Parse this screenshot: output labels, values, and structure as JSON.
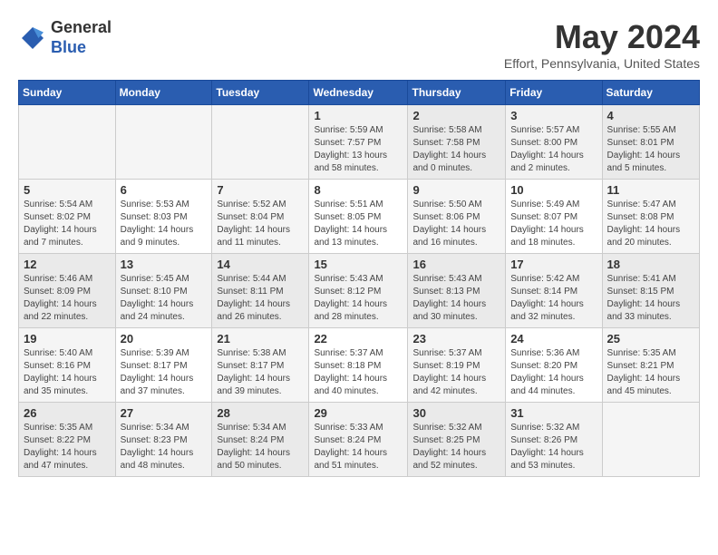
{
  "header": {
    "logo_general": "General",
    "logo_blue": "Blue",
    "month_title": "May 2024",
    "location": "Effort, Pennsylvania, United States"
  },
  "weekdays": [
    "Sunday",
    "Monday",
    "Tuesday",
    "Wednesday",
    "Thursday",
    "Friday",
    "Saturday"
  ],
  "weeks": [
    [
      {
        "day": "",
        "info": ""
      },
      {
        "day": "",
        "info": ""
      },
      {
        "day": "",
        "info": ""
      },
      {
        "day": "1",
        "info": "Sunrise: 5:59 AM\nSunset: 7:57 PM\nDaylight: 13 hours\nand 58 minutes."
      },
      {
        "day": "2",
        "info": "Sunrise: 5:58 AM\nSunset: 7:58 PM\nDaylight: 14 hours\nand 0 minutes."
      },
      {
        "day": "3",
        "info": "Sunrise: 5:57 AM\nSunset: 8:00 PM\nDaylight: 14 hours\nand 2 minutes."
      },
      {
        "day": "4",
        "info": "Sunrise: 5:55 AM\nSunset: 8:01 PM\nDaylight: 14 hours\nand 5 minutes."
      }
    ],
    [
      {
        "day": "5",
        "info": "Sunrise: 5:54 AM\nSunset: 8:02 PM\nDaylight: 14 hours\nand 7 minutes."
      },
      {
        "day": "6",
        "info": "Sunrise: 5:53 AM\nSunset: 8:03 PM\nDaylight: 14 hours\nand 9 minutes."
      },
      {
        "day": "7",
        "info": "Sunrise: 5:52 AM\nSunset: 8:04 PM\nDaylight: 14 hours\nand 11 minutes."
      },
      {
        "day": "8",
        "info": "Sunrise: 5:51 AM\nSunset: 8:05 PM\nDaylight: 14 hours\nand 13 minutes."
      },
      {
        "day": "9",
        "info": "Sunrise: 5:50 AM\nSunset: 8:06 PM\nDaylight: 14 hours\nand 16 minutes."
      },
      {
        "day": "10",
        "info": "Sunrise: 5:49 AM\nSunset: 8:07 PM\nDaylight: 14 hours\nand 18 minutes."
      },
      {
        "day": "11",
        "info": "Sunrise: 5:47 AM\nSunset: 8:08 PM\nDaylight: 14 hours\nand 20 minutes."
      }
    ],
    [
      {
        "day": "12",
        "info": "Sunrise: 5:46 AM\nSunset: 8:09 PM\nDaylight: 14 hours\nand 22 minutes."
      },
      {
        "day": "13",
        "info": "Sunrise: 5:45 AM\nSunset: 8:10 PM\nDaylight: 14 hours\nand 24 minutes."
      },
      {
        "day": "14",
        "info": "Sunrise: 5:44 AM\nSunset: 8:11 PM\nDaylight: 14 hours\nand 26 minutes."
      },
      {
        "day": "15",
        "info": "Sunrise: 5:43 AM\nSunset: 8:12 PM\nDaylight: 14 hours\nand 28 minutes."
      },
      {
        "day": "16",
        "info": "Sunrise: 5:43 AM\nSunset: 8:13 PM\nDaylight: 14 hours\nand 30 minutes."
      },
      {
        "day": "17",
        "info": "Sunrise: 5:42 AM\nSunset: 8:14 PM\nDaylight: 14 hours\nand 32 minutes."
      },
      {
        "day": "18",
        "info": "Sunrise: 5:41 AM\nSunset: 8:15 PM\nDaylight: 14 hours\nand 33 minutes."
      }
    ],
    [
      {
        "day": "19",
        "info": "Sunrise: 5:40 AM\nSunset: 8:16 PM\nDaylight: 14 hours\nand 35 minutes."
      },
      {
        "day": "20",
        "info": "Sunrise: 5:39 AM\nSunset: 8:17 PM\nDaylight: 14 hours\nand 37 minutes."
      },
      {
        "day": "21",
        "info": "Sunrise: 5:38 AM\nSunset: 8:17 PM\nDaylight: 14 hours\nand 39 minutes."
      },
      {
        "day": "22",
        "info": "Sunrise: 5:37 AM\nSunset: 8:18 PM\nDaylight: 14 hours\nand 40 minutes."
      },
      {
        "day": "23",
        "info": "Sunrise: 5:37 AM\nSunset: 8:19 PM\nDaylight: 14 hours\nand 42 minutes."
      },
      {
        "day": "24",
        "info": "Sunrise: 5:36 AM\nSunset: 8:20 PM\nDaylight: 14 hours\nand 44 minutes."
      },
      {
        "day": "25",
        "info": "Sunrise: 5:35 AM\nSunset: 8:21 PM\nDaylight: 14 hours\nand 45 minutes."
      }
    ],
    [
      {
        "day": "26",
        "info": "Sunrise: 5:35 AM\nSunset: 8:22 PM\nDaylight: 14 hours\nand 47 minutes."
      },
      {
        "day": "27",
        "info": "Sunrise: 5:34 AM\nSunset: 8:23 PM\nDaylight: 14 hours\nand 48 minutes."
      },
      {
        "day": "28",
        "info": "Sunrise: 5:34 AM\nSunset: 8:24 PM\nDaylight: 14 hours\nand 50 minutes."
      },
      {
        "day": "29",
        "info": "Sunrise: 5:33 AM\nSunset: 8:24 PM\nDaylight: 14 hours\nand 51 minutes."
      },
      {
        "day": "30",
        "info": "Sunrise: 5:32 AM\nSunset: 8:25 PM\nDaylight: 14 hours\nand 52 minutes."
      },
      {
        "day": "31",
        "info": "Sunrise: 5:32 AM\nSunset: 8:26 PM\nDaylight: 14 hours\nand 53 minutes."
      },
      {
        "day": "",
        "info": ""
      }
    ]
  ]
}
